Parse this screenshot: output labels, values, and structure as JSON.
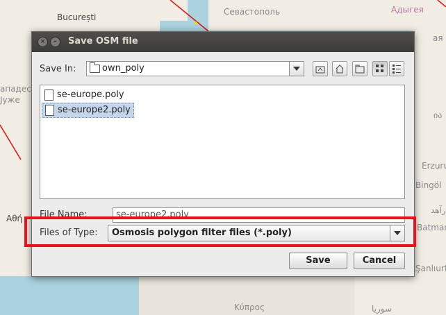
{
  "map": {
    "labels": {
      "bucharest": "București",
      "sevastopol": "Севастополь",
      "adygea": "Адыгея",
      "left_1": "ападес",
      "left_2": "Јуже",
      "athens": "Αθή",
      "right_1": "ая",
      "right_2": "ია",
      "right_3": "Erzuru",
      "right_4": "Bingöl",
      "right_5": "رآهد",
      "right_6": "Batman",
      "right_7": "Şanlıurf",
      "cyprus": "Κύπρος",
      "bottom_right": "سوريا"
    }
  },
  "dialog": {
    "title": "Save OSM file",
    "close_glyph": "×",
    "min_glyph": "–",
    "save_in_label": "Save In:",
    "save_in_value": "own_poly",
    "files": [
      {
        "name": "se-europe.poly",
        "selected": false
      },
      {
        "name": "se-europe2.poly",
        "selected": true
      }
    ],
    "file_name_label": "File Name:",
    "file_name_value": "se-europe2.poly",
    "files_of_type_label": "Files of Type:",
    "files_of_type_value": "Osmosis polygon filter files (*.poly)",
    "save_button": "Save",
    "cancel_button": "Cancel"
  },
  "colors": {
    "highlight": "#e8121f",
    "titlebar": "#3c3b37",
    "selection": "#c5d6ea"
  }
}
